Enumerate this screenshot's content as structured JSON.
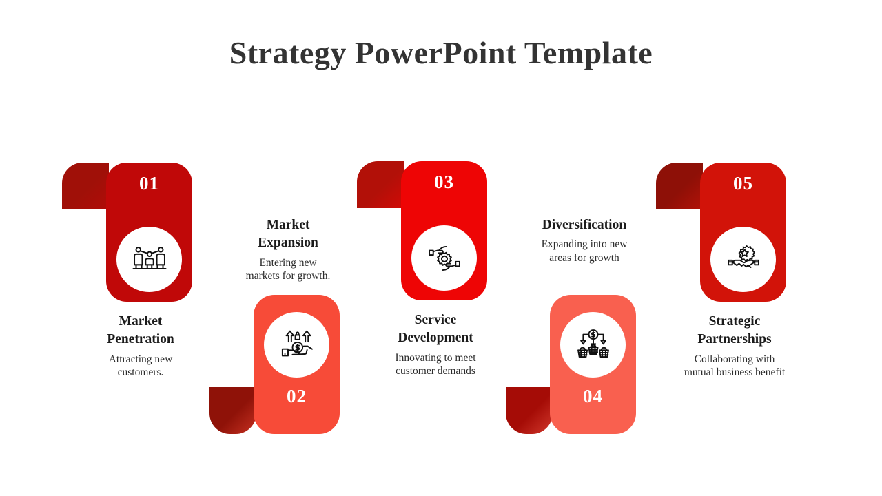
{
  "slide": {
    "title": "Strategy PowerPoint Template",
    "background_color": "#FFFFFF",
    "title_color": "#333333"
  },
  "cards": [
    {
      "number": "01",
      "heading_line1": "Market",
      "heading_line2": "Penetration",
      "desc_line1": "Attracting new",
      "desc_line2": "customers.",
      "icon": "audience-growth-icon",
      "body_color": "#C00808",
      "tab_color": "#A01008",
      "orientation": "up"
    },
    {
      "number": "02",
      "heading_line1": "Market",
      "heading_line2": "Expansion",
      "desc_line1": "Entering new",
      "desc_line2": "markets for growth.",
      "icon": "money-growth-hand-icon",
      "body_color": "#F74B38",
      "tab_color": "#8F1208",
      "orientation": "down"
    },
    {
      "number": "03",
      "heading_line1": "Service",
      "heading_line2": "Development",
      "desc_line1": "Innovating to meet",
      "desc_line2": "customer demands",
      "icon": "hands-gear-icon",
      "body_color": "#EE0505",
      "tab_color": "#B21008",
      "orientation": "up"
    },
    {
      "number": "04",
      "heading_line1": "Diversification",
      "heading_line2": "",
      "desc_line1": "Expanding into new",
      "desc_line2": "areas for growth",
      "icon": "dollar-baskets-icon",
      "body_color": "#F9604F",
      "tab_color": "#A50C06",
      "orientation": "down"
    },
    {
      "number": "05",
      "heading_line1": "Strategic",
      "heading_line2": "Partnerships",
      "desc_line1": "Collaborating with",
      "desc_line2": "mutual business benefit",
      "icon": "handshake-gear-icon",
      "body_color": "#D21309",
      "tab_color": "#8E1007",
      "orientation": "up"
    }
  ]
}
